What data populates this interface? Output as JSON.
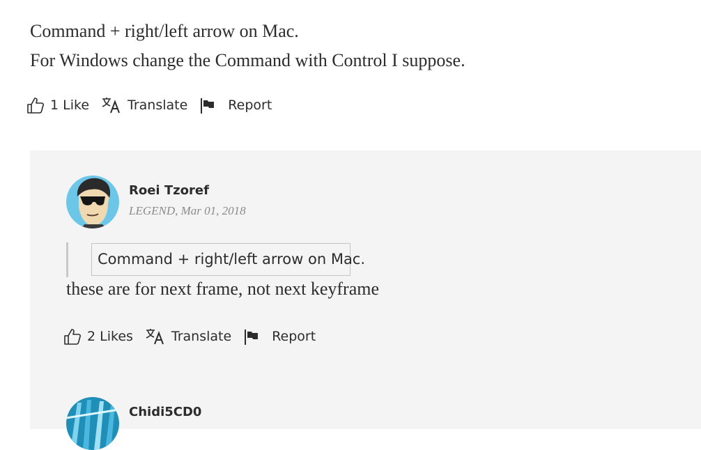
{
  "post": {
    "lines": [
      "Command + right/left arrow on Mac.",
      "For Windows change the Command with Control I suppose."
    ],
    "actions": {
      "likes": "1 Like",
      "translate": "Translate",
      "report": "Report"
    }
  },
  "reply": {
    "author": "Roei Tzoref",
    "badge": "LEGEND",
    "date": ", Mar 01, 2018",
    "quote": "Command + right/left arrow on Mac.",
    "text": "these are for next frame, not next keyframe",
    "actions": {
      "likes": "2 Likes",
      "translate": "Translate",
      "report": "Report"
    }
  },
  "next_reply": {
    "author": "Chidi5CD0"
  },
  "icons": {
    "like": "thumbs-up-icon",
    "translate": "translate-icon",
    "report": "flag-icon"
  },
  "colors": {
    "card_bg": "#f4f4f4",
    "text": "#2c2c2c",
    "meta": "#8a8a8a"
  }
}
